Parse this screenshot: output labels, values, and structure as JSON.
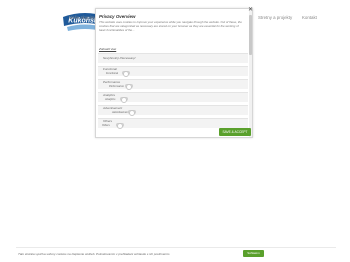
{
  "header": {
    "logo_text": "Kukoňská",
    "nav": {
      "nase_skupiny": "Naše skupiny",
      "stretny": "Stretny a projekty",
      "kontakt": "Kontakt"
    }
  },
  "privacy_modal": {
    "title": "Privacy Overview",
    "description": "This website uses cookies to improve your experience while you navigate through the website. Out of these, the cookies that are categorized as necessary are stored on your browser as they are essential for the working of basic functionalities of the...",
    "details_link": "Zobraziť viac",
    "close_label": "✕",
    "categories": [
      {
        "label": "Nevyhnutný /Necessary/"
      },
      {
        "label": "Functional",
        "sub": "Functional"
      },
      {
        "label": "Performance",
        "sub": "Performance"
      },
      {
        "label": "Analytics",
        "sub": "Analytics"
      },
      {
        "label": "Advertisement",
        "sub": "Advertisement"
      },
      {
        "label": "Others",
        "sub": "Others"
      }
    ],
    "save_button": "SAVE & ACCEPT"
  },
  "cookie_bar": {
    "text": "Táto stránka využíva súbory cookies na zlepšenie služieb. Pokračovaním v prehliadaní súhlasíte s ich používaním.",
    "accept_button": "Súhlasím"
  },
  "colors": {
    "accent": "#5aa02c",
    "logo_blue": "#1f5a9a"
  }
}
